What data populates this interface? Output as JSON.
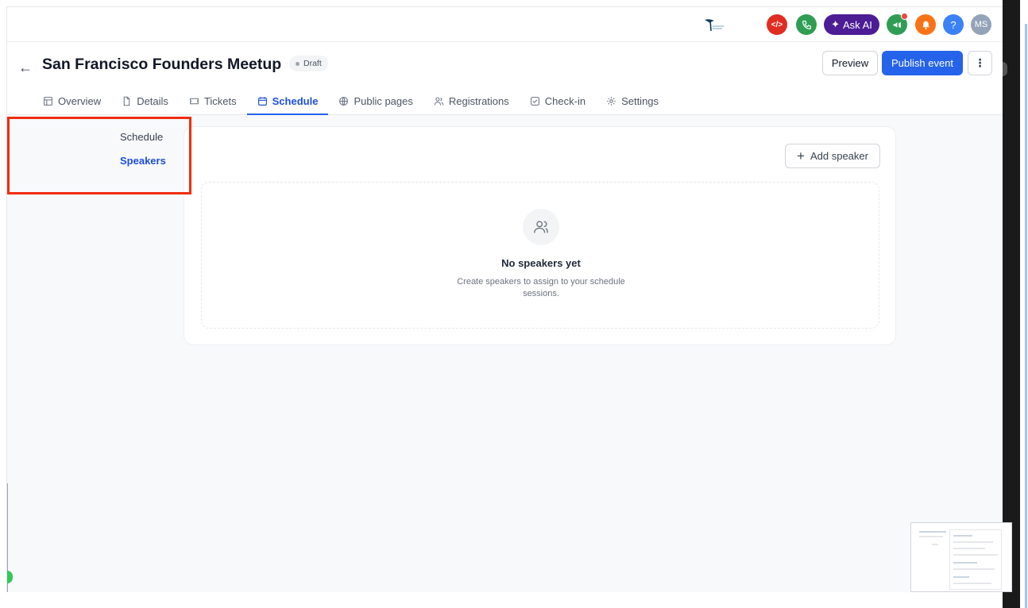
{
  "topbar": {
    "ask_ai_label": "Ask AI",
    "help_label": "?",
    "avatar_initials": "MS",
    "colors": {
      "code": "#e02d22",
      "phone": "#2f9e54",
      "ask_ai": "#4c1d95",
      "announce": "#2f9e54",
      "bell": "#f97316",
      "help": "#3b82f6",
      "avatar": "#94a3b8"
    }
  },
  "header": {
    "title": "San Francisco Founders Meetup",
    "status_badge": "Draft",
    "preview_label": "Preview",
    "publish_label": "Publish event"
  },
  "tabs": [
    {
      "label": "Overview",
      "icon": "layout-icon"
    },
    {
      "label": "Details",
      "icon": "file-icon"
    },
    {
      "label": "Tickets",
      "icon": "ticket-icon"
    },
    {
      "label": "Schedule",
      "icon": "calendar-icon",
      "active": true
    },
    {
      "label": "Public pages",
      "icon": "globe-icon"
    },
    {
      "label": "Registrations",
      "icon": "users-icon"
    },
    {
      "label": "Check-in",
      "icon": "check-square-icon"
    },
    {
      "label": "Settings",
      "icon": "gear-icon"
    }
  ],
  "sidenav": {
    "items": [
      {
        "label": "Schedule",
        "active": false
      },
      {
        "label": "Speakers",
        "active": true
      }
    ]
  },
  "speakers": {
    "add_label": "Add speaker",
    "empty_title": "No speakers yet",
    "empty_desc": "Create speakers to assign to your schedule sessions."
  }
}
